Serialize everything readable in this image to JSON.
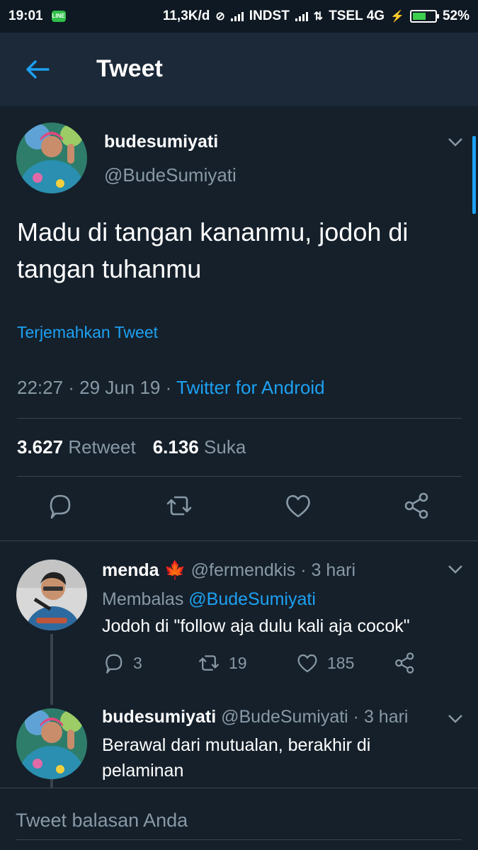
{
  "statusbar": {
    "time": "19:01",
    "line_badge": "LINE",
    "speed": "11,3K/d",
    "carrier1": "INDST",
    "carrier2": "TSEL 4G",
    "battery": "52%",
    "battery_level": 0.52
  },
  "appbar": {
    "title": "Tweet"
  },
  "tweet": {
    "name": "budesumiyati",
    "handle": "@BudeSumiyati",
    "text": "Madu di tangan kananmu, jodoh di tangan tuhanmu",
    "translate": "Terjemahkan Tweet",
    "time": "22:27 · 29 Jun 19 · ",
    "source": "Twitter for Android",
    "retweets": "3.627",
    "retweet_label": "Retweet",
    "likes": "6.136",
    "like_label": "Suka"
  },
  "replies": [
    {
      "name": "menda",
      "handle": "@fermendkis · 3 hari",
      "replying_prefix": "Membalas ",
      "replying_to": "@BudeSumiyati",
      "text": "Jodoh di \"follow aja dulu kali aja cocok\"",
      "reply_count": "3",
      "retweet_count": "19",
      "like_count": "185"
    },
    {
      "name": "budesumiyati",
      "handle": "@BudeSumiyati · 3 hari",
      "text": "Berawal dari mutualan, berakhir di pelaminan"
    }
  ],
  "compose": {
    "placeholder": "Tweet balasan Anda"
  },
  "colors": {
    "background": "#15202b",
    "appbar": "#1c2938",
    "accent": "#1da1f2",
    "muted": "#8899a6"
  },
  "icons": [
    "back-arrow-icon",
    "chevron-down-icon",
    "reply-icon",
    "retweet-icon",
    "like-icon",
    "share-icon",
    "maple-leaf-icon"
  ]
}
